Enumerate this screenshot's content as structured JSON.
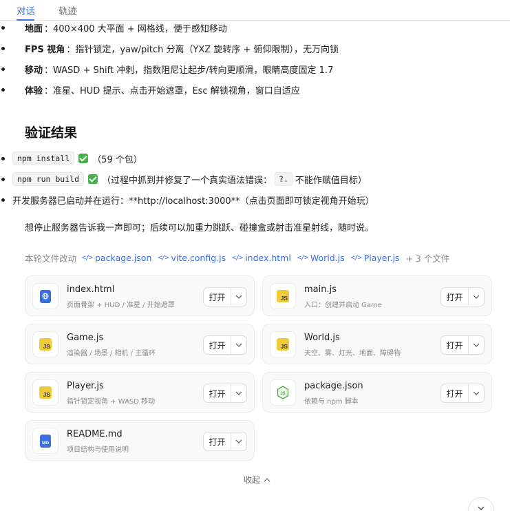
{
  "tabs": [
    {
      "label": "对话",
      "active": true
    },
    {
      "label": "轨迹",
      "active": false
    }
  ],
  "features": [
    {
      "label": "地面",
      "text": "：400×400 大平面 + 网格线，便于感知移动"
    },
    {
      "label": "FPS 视角",
      "text": "：指针锁定，yaw/pitch 分离（YXZ 旋转序 + 俯仰限制），无万向锁"
    },
    {
      "label": "移动",
      "text": "：WASD + Shift 冲刺，指数阻尼让起步/转向更顺滑，眼睛高度固定 1.7"
    },
    {
      "label": "体验",
      "text": "：准星、HUD 提示、点击开始遮罩，Esc 解锁视角，窗口自适应"
    }
  ],
  "verification": {
    "title": "验证结果",
    "install_cmd": "npm install",
    "install_result": "（59 个包）",
    "build_cmd": "npm run build",
    "build_result_before": "（过程中抓到并修复了一个真实语法错误：",
    "build_error_code": "?.",
    "build_result_after": "不能作赋值目标）",
    "server_text": "开发服务器已启动并在运行：**http://localhost:3000**（点击页面即可锁定视角开始玩）"
  },
  "closing_text": "想停止服务器告诉我一声即可；后续可以加重力跳跃、碰撞盒或射击准星射线，随时说。",
  "changes": {
    "label": "本轮文件改动",
    "links": [
      "package.json",
      "vite.config.js",
      "index.html",
      "World.js",
      "Player.js"
    ],
    "more": "+ 3 个文件"
  },
  "files": [
    {
      "name": "index.html",
      "desc": "页面骨架 + HUD / 准星 / 开始遮罩",
      "icon": "html-file-icon"
    },
    {
      "name": "main.js",
      "desc": "入口：创建并启动 Game",
      "icon": "js-file-icon"
    },
    {
      "name": "Game.js",
      "desc": "渲染器 / 场景 / 相机 / 主循环",
      "icon": "js-file-icon"
    },
    {
      "name": "World.js",
      "desc": "天空、雾、灯光、地面、障碍物",
      "icon": "js-file-icon"
    },
    {
      "name": "Player.js",
      "desc": "指针锁定视角 + WASD 移动",
      "icon": "js-file-icon"
    },
    {
      "name": "package.json",
      "desc": "依赖与 npm 脚本",
      "icon": "node-file-icon"
    },
    {
      "name": "README.md",
      "desc": "项目结构与使用说明",
      "icon": "markdown-file-icon"
    }
  ],
  "open_label": "打开",
  "js_badge": "JS",
  "md_badge": "MD",
  "collapse_label": "收起",
  "colors": {
    "accent": "#3a6fe0",
    "check": "#46b04a",
    "js": "#f0cc3a",
    "node": "#5aa34d"
  }
}
